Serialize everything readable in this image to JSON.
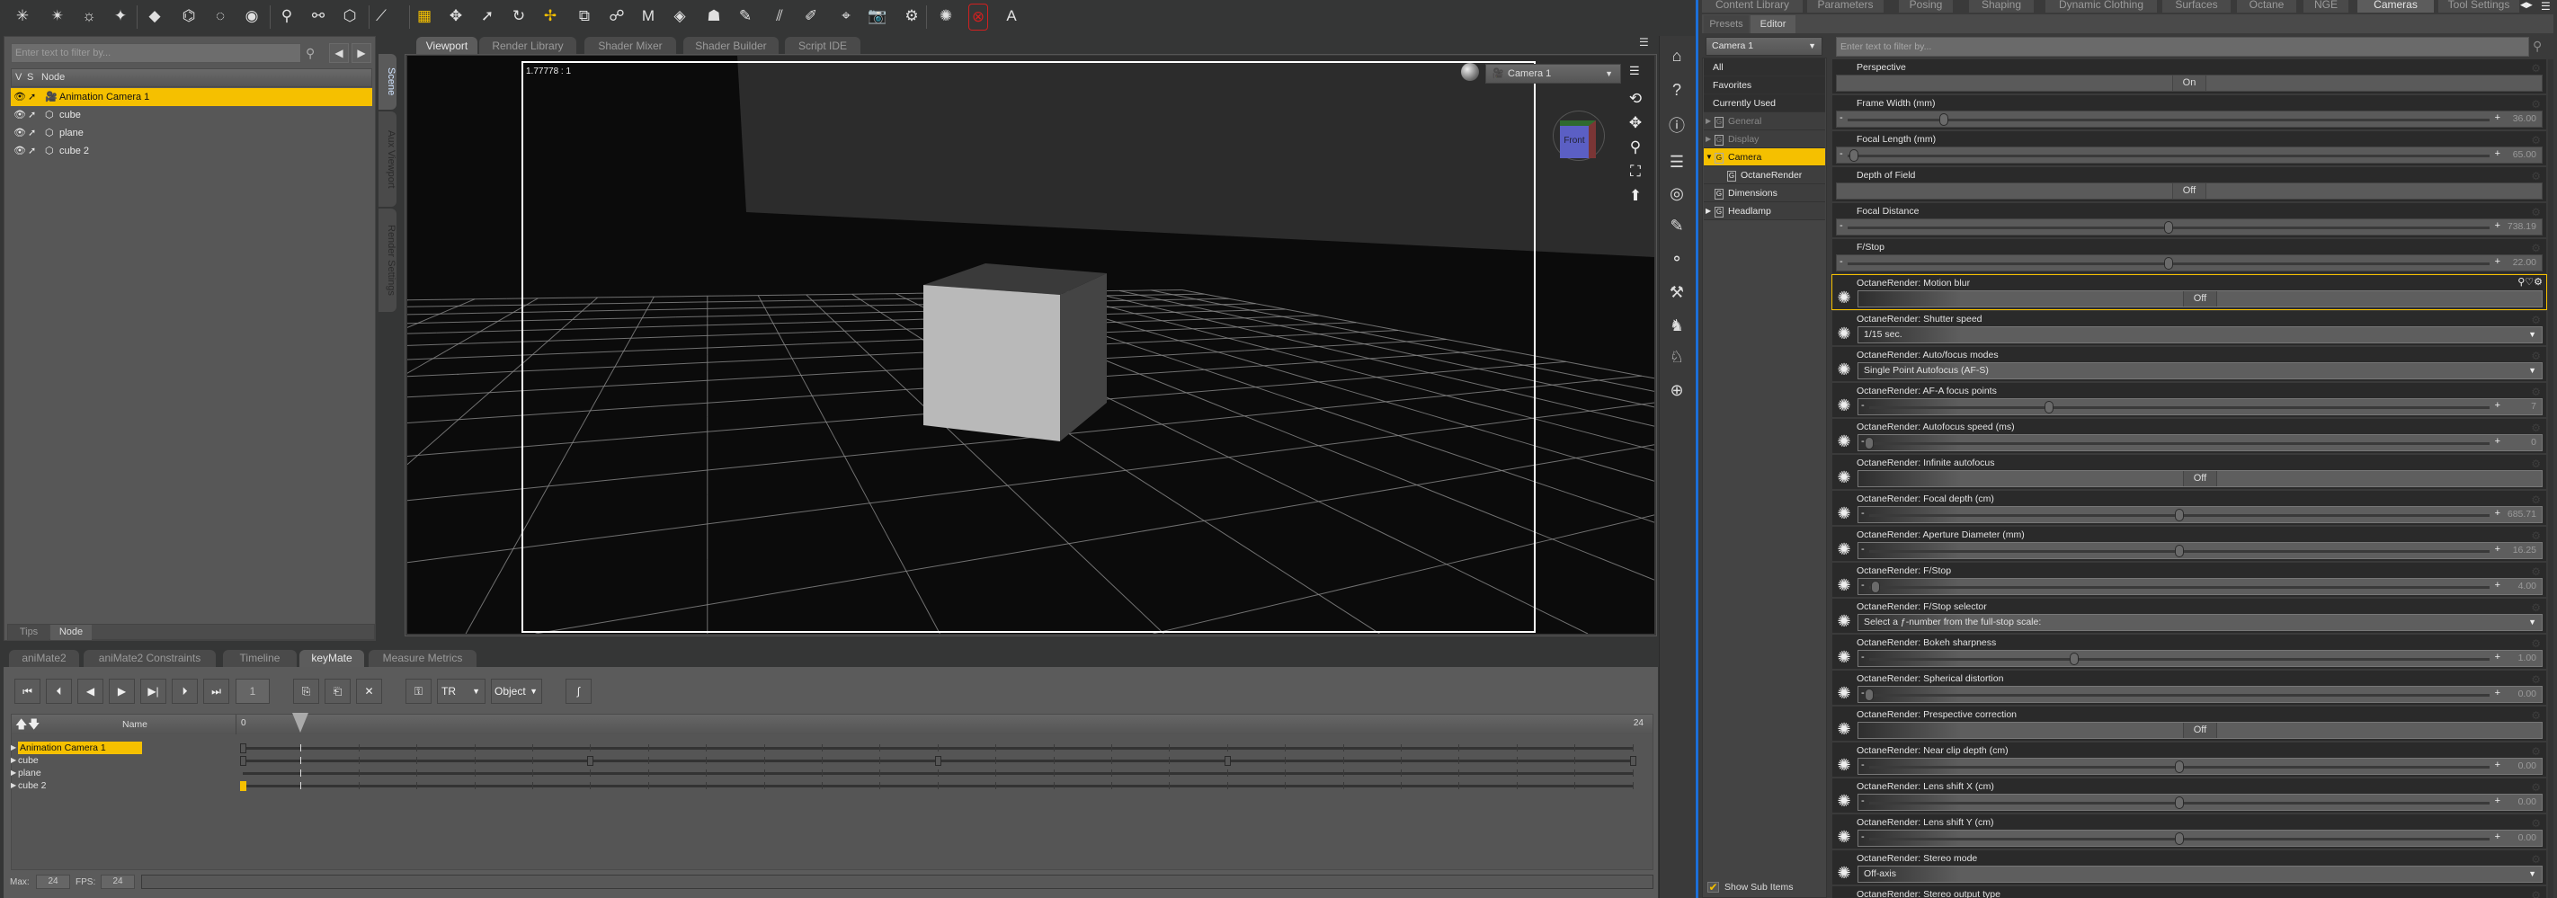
{
  "colors": {
    "accent": "#f5c000",
    "viewport_bg": "#0b0b0b",
    "panel": "#575757",
    "octane_red": "#d02020"
  },
  "toolbar": {
    "icons": [
      "point-light-icon",
      "spot-light-icon",
      "distant-light-icon",
      "linear-point-light-icon",
      "primitive-icon",
      "null-icon",
      "group-icon",
      "camera-target-icon",
      "node-weight-icon",
      "joint-editor-icon",
      "cube-icon",
      "measure-icon",
      "grid-menu-icon",
      "universal-tool-icon",
      "node-selection-icon",
      "rotate-tool-icon",
      "translate-tool-icon",
      "scale-tool-icon",
      "joint-tool-icon",
      "morph-brush-icon",
      "surface-selection-icon",
      "figure-posing-icon",
      "region-navigator-icon",
      "geometry-editor-icon",
      "weight-map-brush-icon",
      "spot-render-icon",
      "render-camera-icon",
      "render-settings-icon",
      "octane-icon",
      "octane-stop-icon",
      "octane-auto-icon"
    ],
    "active_icon": "translate-tool-icon"
  },
  "scene": {
    "filter_placeholder": "Enter text to filter by...",
    "columns": {
      "v": "V",
      "s": "S",
      "node": "Node"
    },
    "nodes": [
      {
        "name": "Animation Camera 1",
        "type": "camera",
        "selected": true
      },
      {
        "name": "cube",
        "type": "figure"
      },
      {
        "name": "plane",
        "type": "figure"
      },
      {
        "name": "cube 2",
        "type": "figure"
      }
    ],
    "bottom_tabs": [
      "Tips",
      "Node"
    ],
    "bottom_tab_active": "Node",
    "side_tabs": [
      "Scene",
      "Aux Viewport",
      "Render Settings"
    ],
    "side_tab_active": "Scene"
  },
  "viewport": {
    "tabs": [
      "Viewport",
      "Render Library",
      "Shader Mixer",
      "Shader Builder",
      "Script IDE"
    ],
    "active_tab": "Viewport",
    "aspect": "1.77778 : 1",
    "camera": "Camera 1",
    "navcube_label": "Front",
    "nav_icons": [
      "orbit-icon",
      "pan-icon",
      "zoom-icon",
      "frame-icon",
      "reset-icon"
    ]
  },
  "side_toolbar": {
    "icons": [
      "daz-home-icon",
      "whats-this-icon",
      "help-icon",
      "layout-icon",
      "octane-logo-icon",
      "pose-edit-icon",
      "bone-tool-icon",
      "weight-edit-icon",
      "character-icon",
      "character-p-icon",
      "world-edit-icon"
    ]
  },
  "timeline": {
    "tabs": [
      "aniMate2",
      "aniMate2 Constraints",
      "Timeline",
      "keyMate",
      "Measure Metrics"
    ],
    "active_tab": "keyMate",
    "current_frame": "1",
    "mode": "TR",
    "scope": "Object",
    "name_header": "Name",
    "start": "0",
    "end": "24",
    "playhead_frame": 1,
    "tracks": [
      {
        "name": "Animation Camera 1",
        "selected": true,
        "keys": [
          0
        ]
      },
      {
        "name": "cube",
        "keys": [
          0,
          6,
          12,
          17,
          24
        ]
      },
      {
        "name": "plane",
        "keys": []
      },
      {
        "name": "cube 2",
        "keys": [
          0
        ],
        "selected_key": 0
      }
    ],
    "max_label": "Max:",
    "max": "24",
    "fps_label": "FPS:",
    "fps": "24"
  },
  "right": {
    "tabs": [
      "Content Library",
      "Parameters",
      "Posing",
      "Shaping",
      "Dynamic Clothing",
      "Surfaces",
      "Octane",
      "NGE",
      "Cameras",
      "Tool Settings"
    ],
    "active_tab": "Cameras",
    "subtabs": [
      "Presets",
      "Editor"
    ],
    "active_subtab": "Editor",
    "camera_select": "Camera 1",
    "filter_placeholder": "Enter text to filter by...",
    "categories": [
      {
        "label": "All",
        "kind": "flat"
      },
      {
        "label": "Favorites",
        "kind": "flat"
      },
      {
        "label": "Currently Used",
        "kind": "flat"
      },
      {
        "label": "General",
        "kind": "group",
        "arrow": "right",
        "dim": true
      },
      {
        "label": "Display",
        "kind": "group",
        "arrow": "right",
        "dim": true
      },
      {
        "label": "Camera",
        "kind": "group",
        "arrow": "down",
        "selected": true
      },
      {
        "label": "OctaneRender",
        "kind": "sub"
      },
      {
        "label": "Dimensions",
        "kind": "group"
      },
      {
        "label": "Headlamp",
        "kind": "group",
        "arrow": "right"
      }
    ],
    "show_sub_items": "Show Sub Items",
    "show_sub_items_checked": true,
    "params": [
      {
        "label": "Perspective",
        "type": "toggle",
        "value": "On"
      },
      {
        "label": "Frame Width (mm)",
        "type": "slider",
        "value": "36.00",
        "fraction": 0.15
      },
      {
        "label": "Focal Length (mm)",
        "type": "slider",
        "value": "65.00",
        "fraction": 0.01
      },
      {
        "label": "Depth of Field",
        "type": "toggle",
        "value": "Off"
      },
      {
        "label": "Focal Distance",
        "type": "slider",
        "value": "738.19",
        "fraction": 0.5
      },
      {
        "label": "F/Stop",
        "type": "slider",
        "value": "22.00",
        "fraction": 0.5
      },
      {
        "label": "OctaneRender: Motion blur",
        "type": "toggle",
        "value": "Off",
        "octane": true,
        "highlight": true
      },
      {
        "label": "OctaneRender: Shutter speed",
        "type": "dropdown",
        "value": "1/15 sec.",
        "octane": true
      },
      {
        "label": "OctaneRender: Auto/focus modes",
        "type": "dropdown",
        "value": "Single Point Autofocus (AF-S)",
        "octane": true
      },
      {
        "label": "OctaneRender: AF-A focus points",
        "type": "slider",
        "value": "7",
        "fraction": 0.29,
        "octane": true
      },
      {
        "label": "OctaneRender: Autofocus speed (ms)",
        "type": "slider",
        "value": "0",
        "fraction": 0.0,
        "octane": true
      },
      {
        "label": "OctaneRender: Infinite autofocus",
        "type": "toggle",
        "value": "Off",
        "octane": true
      },
      {
        "label": "OctaneRender: Focal depth (cm)",
        "type": "slider",
        "value": "685.71",
        "fraction": 0.5,
        "octane": true
      },
      {
        "label": "OctaneRender: Aperture Diameter (mm)",
        "type": "slider",
        "value": "16.25",
        "fraction": 0.5,
        "octane": true
      },
      {
        "label": "OctaneRender: F/Stop",
        "type": "slider",
        "value": "4.00",
        "fraction": 0.01,
        "octane": true
      },
      {
        "label": "OctaneRender: F/Stop selector",
        "type": "dropdown",
        "value": "Select a ƒ-number from the full-stop scale:",
        "octane": true
      },
      {
        "label": "OctaneRender: Bokeh sharpness",
        "type": "slider",
        "value": "1.00",
        "fraction": 0.33,
        "octane": true
      },
      {
        "label": "OctaneRender: Spherical distortion",
        "type": "slider",
        "value": "0.00",
        "fraction": 0.0,
        "octane": true
      },
      {
        "label": "OctaneRender: Prespective correction",
        "type": "toggle",
        "value": "Off",
        "octane": true
      },
      {
        "label": "OctaneRender: Near clip depth (cm)",
        "type": "slider",
        "value": "0.00",
        "fraction": 0.5,
        "octane": true
      },
      {
        "label": "OctaneRender: Lens shift X (cm)",
        "type": "slider",
        "value": "0.00",
        "fraction": 0.5,
        "octane": true
      },
      {
        "label": "OctaneRender: Lens shift Y (cm)",
        "type": "slider",
        "value": "0.00",
        "fraction": 0.5,
        "octane": true
      },
      {
        "label": "OctaneRender: Stereo mode",
        "type": "dropdown",
        "value": "Off-axis",
        "octane": true
      },
      {
        "label": "OctaneRender: Stereo output type",
        "type": "dropdown",
        "value": "",
        "octane": true
      }
    ]
  }
}
